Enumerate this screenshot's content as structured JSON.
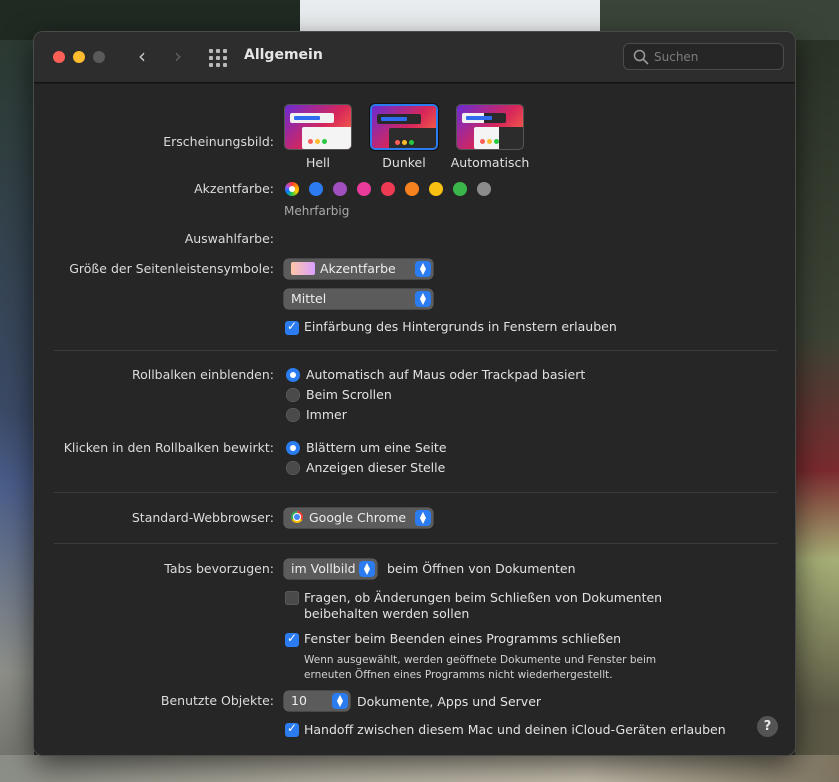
{
  "window": {
    "title": "Allgemein",
    "search_placeholder": "Suchen"
  },
  "appearance": {
    "label": "Erscheinungsbild:",
    "options": [
      "Hell",
      "Dunkel",
      "Automatisch"
    ],
    "selected": "Dunkel"
  },
  "accent": {
    "label": "Akzentfarbe:",
    "selected_caption": "Mehrfarbig",
    "colors": [
      "multicolor",
      "#2b7cf0",
      "#a14fbf",
      "#ea3a9a",
      "#ee3a53",
      "#f6811f",
      "#f9c111",
      "#3ab54a",
      "#8c8c8c"
    ]
  },
  "highlight": {
    "label": "Auswahlfarbe:",
    "value": "Akzentfarbe"
  },
  "sidebar_icon_size": {
    "label": "Größe der Seitenleistensymbole:",
    "value": "Mittel"
  },
  "wallpaper_tinting": {
    "label": "Einfärbung des Hintergrunds in Fenstern erlauben",
    "checked": true
  },
  "scrollbars": {
    "label": "Rollbalken einblenden:",
    "options": [
      "Automatisch auf Maus oder Trackpad basiert",
      "Beim Scrollen",
      "Immer"
    ],
    "selected": 0
  },
  "scroll_click": {
    "label": "Klicken in den Rollbalken bewirkt:",
    "options": [
      "Blättern um eine Seite",
      "Anzeigen dieser Stelle"
    ],
    "selected": 0
  },
  "browser": {
    "label": "Standard-Webbrowser:",
    "value": "Google Chrome"
  },
  "tabs": {
    "label": "Tabs bevorzugen:",
    "value": "im Vollbild",
    "suffix": "beim Öffnen von Dokumenten"
  },
  "ask_keep_changes": {
    "line1": "Fragen, ob Änderungen beim Schließen von Dokumenten",
    "line2": "beibehalten werden sollen",
    "checked": false
  },
  "close_windows": {
    "label": "Fenster beim Beenden eines Programms schließen",
    "note1": "Wenn ausgewählt, werden geöffnete Dokumente und Fenster beim",
    "note2": "erneuten Öffnen eines Programms nicht wiederhergestellt.",
    "checked": true
  },
  "recent_items": {
    "label": "Benutzte Objekte:",
    "value": "10",
    "suffix": "Dokumente, Apps und Server"
  },
  "handoff": {
    "label": "Handoff zwischen diesem Mac und deinen iCloud-Geräten erlauben",
    "checked": true
  },
  "help": {
    "symbol": "?"
  }
}
